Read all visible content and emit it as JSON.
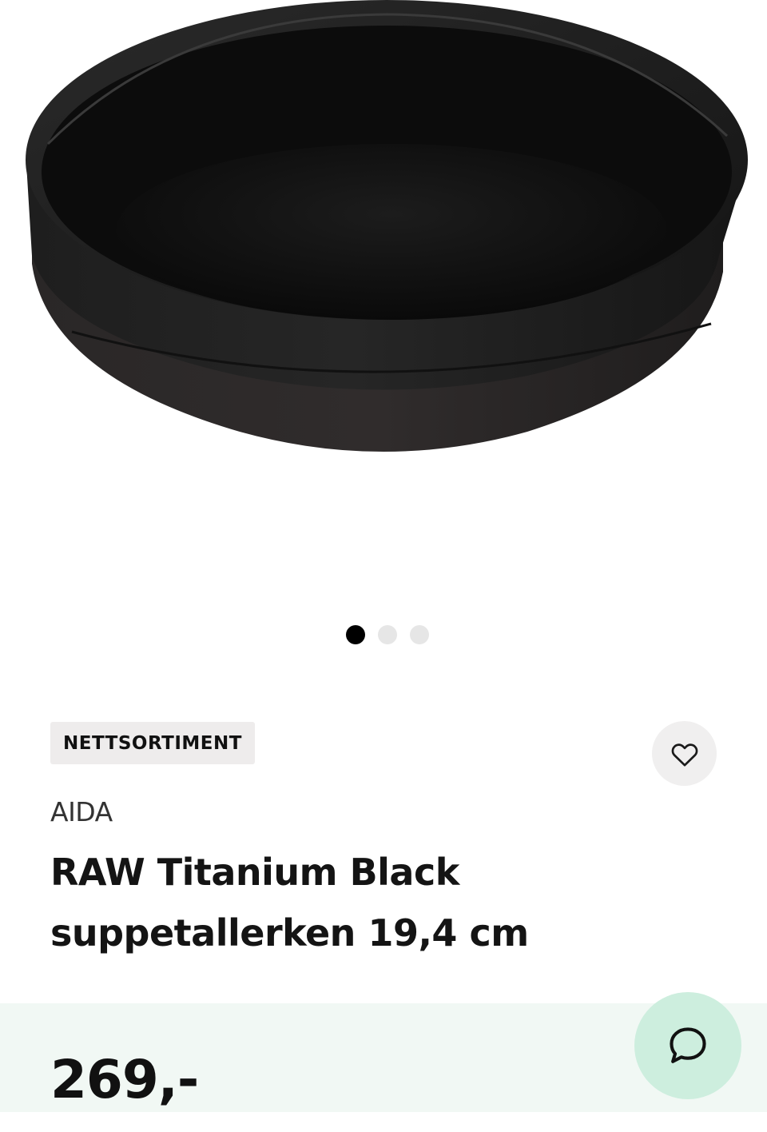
{
  "product": {
    "image_alt": "Black round soup bowl",
    "badge": "NETTSORTIMENT",
    "brand": "AIDA",
    "title_line1": "RAW Titanium Black",
    "title_line2": "suppetallerken 19,4 cm",
    "price": "269,-"
  },
  "carousel": {
    "total": 3,
    "active_index": 0
  },
  "icons": {
    "favorite": "heart-icon",
    "chat": "chat-bubble-icon"
  },
  "colors": {
    "price_bar_bg": "#f1f8f4",
    "chat_button_bg": "#cdeede",
    "badge_bg": "#eeecec",
    "dot_active": "#000000",
    "dot_inactive": "#e6e6e6"
  }
}
